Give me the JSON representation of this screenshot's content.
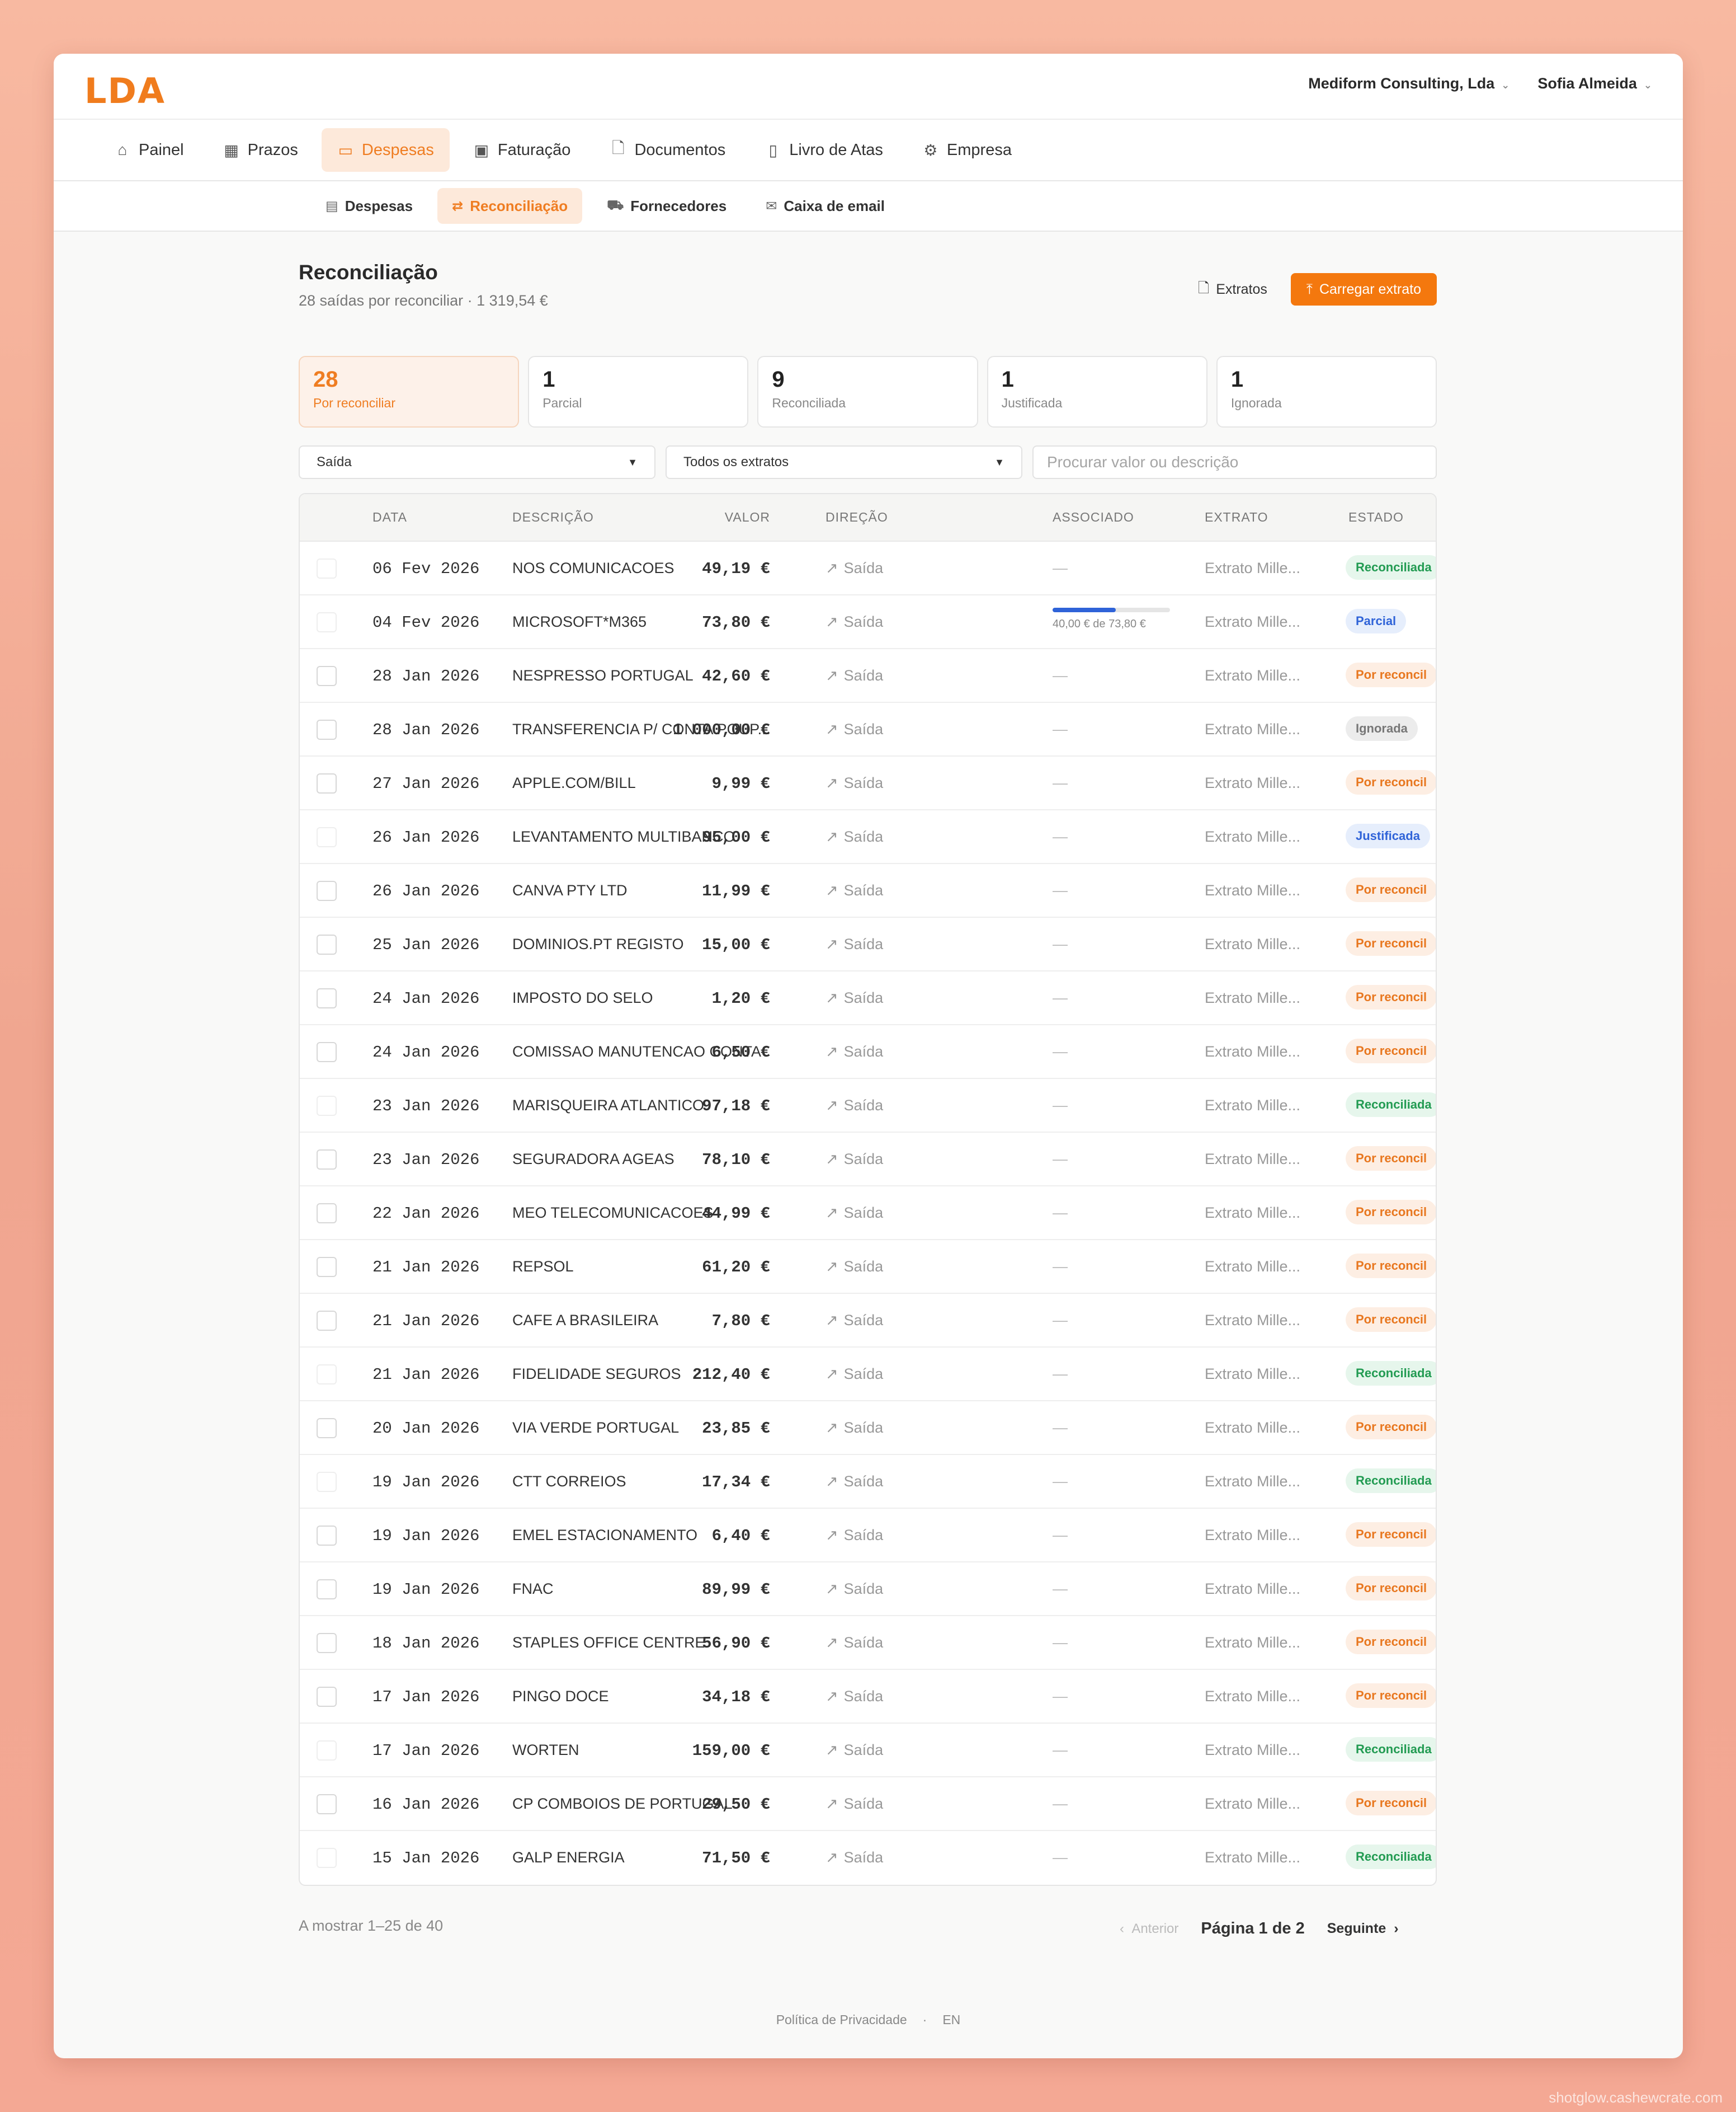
{
  "app": {
    "logo": "LDA",
    "company": "Mediform Consulting, Lda",
    "user": "Sofia Almeida"
  },
  "mainnav": [
    {
      "label": "Painel",
      "icon": "home-icon"
    },
    {
      "label": "Prazos",
      "icon": "calendar-icon"
    },
    {
      "label": "Despesas",
      "icon": "credit-card-icon",
      "active": true
    },
    {
      "label": "Faturação",
      "icon": "banknote-icon"
    },
    {
      "label": "Documentos",
      "icon": "file-icon"
    },
    {
      "label": "Livro de Atas",
      "icon": "book-icon"
    },
    {
      "label": "Empresa",
      "icon": "gear-icon"
    }
  ],
  "subnav": [
    {
      "label": "Despesas",
      "icon": "receipt-icon"
    },
    {
      "label": "Reconciliação",
      "icon": "swap-icon",
      "active": true
    },
    {
      "label": "Fornecedores",
      "icon": "truck-icon"
    },
    {
      "label": "Caixa de email",
      "icon": "mail-icon"
    }
  ],
  "page": {
    "title": "Reconciliação",
    "subtitle": "28 saídas por reconciliar · 1 319,54 €",
    "extratos_label": "Extratos",
    "upload_label": "Carregar extrato"
  },
  "stats": [
    {
      "num": "28",
      "label": "Por reconciliar",
      "active": true
    },
    {
      "num": "1",
      "label": "Parcial"
    },
    {
      "num": "9",
      "label": "Reconciliada"
    },
    {
      "num": "1",
      "label": "Justificada"
    },
    {
      "num": "1",
      "label": "Ignorada"
    }
  ],
  "filters": {
    "direction": "Saída",
    "statement": "Todos os extratos",
    "search_placeholder": "Procurar valor ou descrição"
  },
  "table": {
    "headers": {
      "date": "DATA",
      "desc": "DESCRIÇÃO",
      "dir": "DIREÇÃO",
      "val": "VALOR",
      "assoc": "ASSOCIADO",
      "ext": "EXTRATO",
      "state": "ESTADO"
    },
    "rows": [
      {
        "date": "06 Fev 2026",
        "desc": "NOS COMUNICACOES",
        "dir": "Saída",
        "val": "49,19 €",
        "assoc": "—",
        "ext": "Extrato Mille...",
        "state": "Reconciliada",
        "kind": "rec"
      },
      {
        "date": "04 Fev 2026",
        "desc": "MICROSOFT*M365",
        "dir": "Saída",
        "val": "73,80 €",
        "assoc": "40,00 € de 73,80 €",
        "progress": 0.54,
        "ext": "Extrato Mille...",
        "state": "Parcial",
        "kind": "par"
      },
      {
        "date": "28 Jan 2026",
        "desc": "NESPRESSO PORTUGAL",
        "dir": "Saída",
        "val": "42,60 €",
        "assoc": "—",
        "ext": "Extrato Mille...",
        "state": "Por reconcil",
        "kind": "por"
      },
      {
        "date": "28 Jan 2026",
        "desc": "TRANSFERENCIA P/ CONTA POUP...",
        "dir": "Saída",
        "val": "1 000,00 €",
        "assoc": "—",
        "ext": "Extrato Mille...",
        "state": "Ignorada",
        "kind": "ign"
      },
      {
        "date": "27 Jan 2026",
        "desc": "APPLE.COM/BILL",
        "dir": "Saída",
        "val": "9,99 €",
        "assoc": "—",
        "ext": "Extrato Mille...",
        "state": "Por reconcil",
        "kind": "por"
      },
      {
        "date": "26 Jan 2026",
        "desc": "LEVANTAMENTO MULTIBANCO",
        "dir": "Saída",
        "val": "95,00 €",
        "assoc": "—",
        "ext": "Extrato Mille...",
        "state": "Justificada",
        "kind": "jus"
      },
      {
        "date": "26 Jan 2026",
        "desc": "CANVA PTY LTD",
        "dir": "Saída",
        "val": "11,99 €",
        "assoc": "—",
        "ext": "Extrato Mille...",
        "state": "Por reconcil",
        "kind": "por"
      },
      {
        "date": "25 Jan 2026",
        "desc": "DOMINIOS.PT REGISTO",
        "dir": "Saída",
        "val": "15,00 €",
        "assoc": "—",
        "ext": "Extrato Mille...",
        "state": "Por reconcil",
        "kind": "por"
      },
      {
        "date": "24 Jan 2026",
        "desc": "IMPOSTO DO SELO",
        "dir": "Saída",
        "val": "1,20 €",
        "assoc": "—",
        "ext": "Extrato Mille...",
        "state": "Por reconcil",
        "kind": "por"
      },
      {
        "date": "24 Jan 2026",
        "desc": "COMISSAO MANUTENCAO CONTA",
        "dir": "Saída",
        "val": "6,50 €",
        "assoc": "—",
        "ext": "Extrato Mille...",
        "state": "Por reconcil",
        "kind": "por"
      },
      {
        "date": "23 Jan 2026",
        "desc": "MARISQUEIRA ATLANTICO",
        "dir": "Saída",
        "val": "97,18 €",
        "assoc": "—",
        "ext": "Extrato Mille...",
        "state": "Reconciliada",
        "kind": "rec"
      },
      {
        "date": "23 Jan 2026",
        "desc": "SEGURADORA AGEAS",
        "dir": "Saída",
        "val": "78,10 €",
        "assoc": "—",
        "ext": "Extrato Mille...",
        "state": "Por reconcil",
        "kind": "por"
      },
      {
        "date": "22 Jan 2026",
        "desc": "MEO TELECOMUNICACOES",
        "dir": "Saída",
        "val": "44,99 €",
        "assoc": "—",
        "ext": "Extrato Mille...",
        "state": "Por reconcil",
        "kind": "por"
      },
      {
        "date": "21 Jan 2026",
        "desc": "REPSOL",
        "dir": "Saída",
        "val": "61,20 €",
        "assoc": "—",
        "ext": "Extrato Mille...",
        "state": "Por reconcil",
        "kind": "por"
      },
      {
        "date": "21 Jan 2026",
        "desc": "CAFE A BRASILEIRA",
        "dir": "Saída",
        "val": "7,80 €",
        "assoc": "—",
        "ext": "Extrato Mille...",
        "state": "Por reconcil",
        "kind": "por"
      },
      {
        "date": "21 Jan 2026",
        "desc": "FIDELIDADE SEGUROS",
        "dir": "Saída",
        "val": "212,40 €",
        "assoc": "—",
        "ext": "Extrato Mille...",
        "state": "Reconciliada",
        "kind": "rec"
      },
      {
        "date": "20 Jan 2026",
        "desc": "VIA VERDE PORTUGAL",
        "dir": "Saída",
        "val": "23,85 €",
        "assoc": "—",
        "ext": "Extrato Mille...",
        "state": "Por reconcil",
        "kind": "por"
      },
      {
        "date": "19 Jan 2026",
        "desc": "CTT CORREIOS",
        "dir": "Saída",
        "val": "17,34 €",
        "assoc": "—",
        "ext": "Extrato Mille...",
        "state": "Reconciliada",
        "kind": "rec"
      },
      {
        "date": "19 Jan 2026",
        "desc": "EMEL ESTACIONAMENTO",
        "dir": "Saída",
        "val": "6,40 €",
        "assoc": "—",
        "ext": "Extrato Mille...",
        "state": "Por reconcil",
        "kind": "por"
      },
      {
        "date": "19 Jan 2026",
        "desc": "FNAC",
        "dir": "Saída",
        "val": "89,99 €",
        "assoc": "—",
        "ext": "Extrato Mille...",
        "state": "Por reconcil",
        "kind": "por"
      },
      {
        "date": "18 Jan 2026",
        "desc": "STAPLES OFFICE CENTRE",
        "dir": "Saída",
        "val": "56,90 €",
        "assoc": "—",
        "ext": "Extrato Mille...",
        "state": "Por reconcil",
        "kind": "por"
      },
      {
        "date": "17 Jan 2026",
        "desc": "PINGO DOCE",
        "dir": "Saída",
        "val": "34,18 €",
        "assoc": "—",
        "ext": "Extrato Mille...",
        "state": "Por reconcil",
        "kind": "por"
      },
      {
        "date": "17 Jan 2026",
        "desc": "WORTEN",
        "dir": "Saída",
        "val": "159,00 €",
        "assoc": "—",
        "ext": "Extrato Mille...",
        "state": "Reconciliada",
        "kind": "rec"
      },
      {
        "date": "16 Jan 2026",
        "desc": "CP COMBOIOS DE PORTUGAL",
        "dir": "Saída",
        "val": "29,50 €",
        "assoc": "—",
        "ext": "Extrato Mille...",
        "state": "Por reconcil",
        "kind": "por"
      },
      {
        "date": "15 Jan 2026",
        "desc": "GALP ENERGIA",
        "dir": "Saída",
        "val": "71,50 €",
        "assoc": "—",
        "ext": "Extrato Mille...",
        "state": "Reconciliada",
        "kind": "rec"
      }
    ]
  },
  "pager": {
    "showing": "A mostrar 1–25 de 40",
    "prev": "Anterior",
    "page": "Página 1 de 2",
    "next": "Seguinte"
  },
  "footer": {
    "privacy": "Política de Privacidade",
    "lang": "EN"
  },
  "watermark": "shotglow.cashewcrate.com",
  "colors": {
    "accent": "#f4780e",
    "accent_bg": "#fde9da",
    "reconciled": "#229b52",
    "partial": "#2f63d8"
  }
}
